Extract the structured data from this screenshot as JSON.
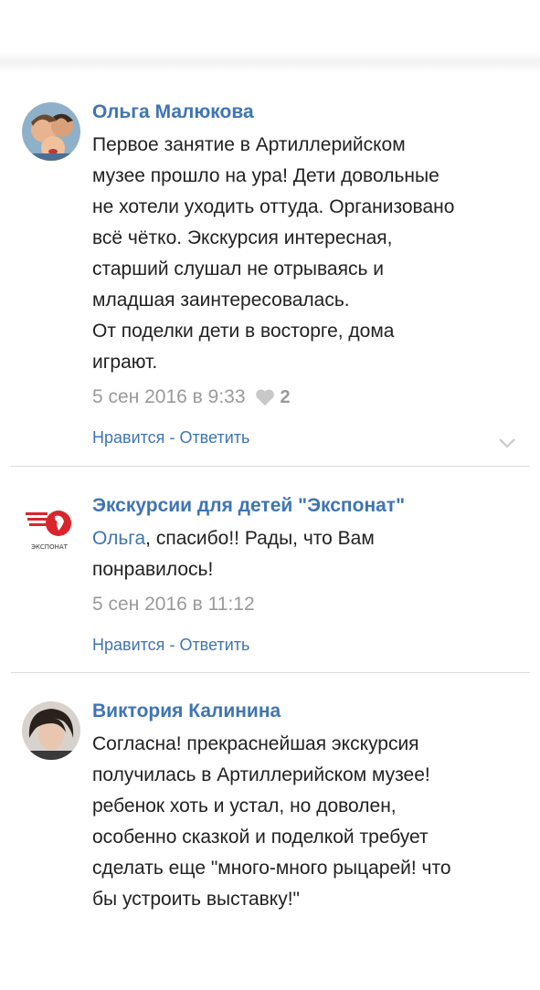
{
  "comments": [
    {
      "author": "Ольга Малюкова",
      "lines": [
        "Первое занятие в Артиллерийском",
        "музее прошло на ура! Дети довольные",
        "не хотели уходить оттуда. Организовано",
        "всё чётко. Экскурсия интересная,",
        "старший слушал не отрываясь и",
        "младшая заинтересовалась.",
        "От поделки дети в восторге, дома",
        "играют."
      ],
      "date": "5 сен 2016 в 9:33",
      "likes": "2",
      "like_label": "Нравится",
      "separator": " - ",
      "reply_label": "Ответить"
    },
    {
      "author": "Экскурсии для детей \"Экспонат\"",
      "mention": "Ольга",
      "first_line_rest": ", спасибо!! Рады, что Вам",
      "second_line": "понравилось!",
      "date": "5 сен 2016 в 11:12",
      "like_label": "Нравится",
      "separator": " - ",
      "reply_label": "Ответить",
      "logo_text": "ЭКСПОНАТ"
    },
    {
      "author": "Виктория Калинина",
      "lines": [
        "Согласна! прекраснейшая экскурсия",
        "получилась в Артиллерийском музее!",
        "ребенок хоть и устал, но доволен,",
        "особенно сказкой и поделкой требует",
        "сделать еще \"много-много рыцарей! что",
        "бы устроить выставку!\""
      ]
    }
  ],
  "colors": {
    "accent": "#3f74b4",
    "logo_red": "#d9252b"
  },
  "icons": [
    "heart-icon",
    "chevron-down-icon"
  ]
}
